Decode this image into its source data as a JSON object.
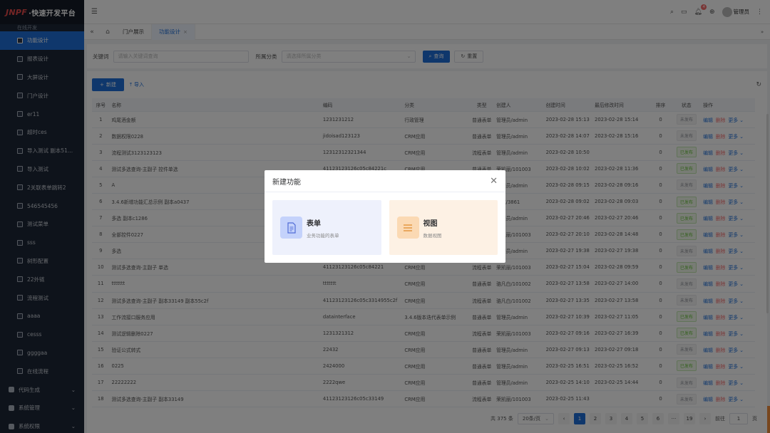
{
  "brand": {
    "logo_j": "J",
    "logo_npf": "NPF",
    "logo_rest": "·快速开发平台"
  },
  "sidebar": {
    "partial_top": "在线开发",
    "items": [
      {
        "label": "功能设计",
        "active": true
      },
      {
        "label": "报表设计"
      },
      {
        "label": "大屏设计"
      },
      {
        "label": "门户设计"
      },
      {
        "label": "er11"
      },
      {
        "label": "超时ces"
      },
      {
        "label": "导入测试 副本51..."
      },
      {
        "label": "导入测试"
      },
      {
        "label": "2关联表单跳转2"
      },
      {
        "label": "546545456"
      },
      {
        "label": "测试菜单"
      },
      {
        "label": "sss"
      },
      {
        "label": "树形配置"
      },
      {
        "label": "22外链"
      },
      {
        "label": "流程测试"
      },
      {
        "label": "aaaa"
      },
      {
        "label": "cesss"
      },
      {
        "label": "ggggaa"
      },
      {
        "label": "在线流程"
      }
    ],
    "groups": [
      {
        "label": "代码生成"
      },
      {
        "label": "系统管理"
      },
      {
        "label": "系统权限"
      }
    ]
  },
  "topbar": {
    "notification_count": "4",
    "user_name": "管理员"
  },
  "tabs": {
    "items": [
      {
        "label": "门户展示"
      },
      {
        "label": "功能设计",
        "active": true
      }
    ]
  },
  "search": {
    "keyword_label": "关键词",
    "keyword_placeholder": "请输入关键词查询",
    "category_label": "所属分类",
    "category_placeholder": "请选择所属分类",
    "query_button": "查询",
    "reset_button": "重置"
  },
  "toolbar": {
    "new_button": "新建",
    "import_button": "导入"
  },
  "table": {
    "headers": [
      "序号",
      "名称",
      "编码",
      "分类",
      "类型",
      "创建人",
      "创建时间",
      "最后修改时间",
      "排序",
      "状态",
      "操作"
    ],
    "actions": {
      "edit": "编辑",
      "delete": "删除",
      "more": "更多"
    },
    "rows": [
      [
        "1",
        "鸡尾酒金额",
        "1231231212",
        "行政管理",
        "普通表单",
        "管理员/admin",
        "2023-02-28 15:13",
        "2023-02-28 15:14",
        "0",
        "未发布"
      ],
      [
        "2",
        "数据权限0228",
        "jidoisad123123",
        "CRM应用",
        "普通表单",
        "管理员/admin",
        "2023-02-28 14:07",
        "2023-02-28 15:16",
        "0",
        "未发布"
      ],
      [
        "3",
        "流程测试3123123123",
        "12312312321344",
        "CRM应用",
        "流程表单",
        "管理员/admin",
        "2023-02-28 10:50",
        "",
        "0",
        "已发布"
      ],
      [
        "4",
        "测试多选查询-主副子 控件单选",
        "41123123126c05c84221c",
        "CRM应用",
        "普通表单",
        "荣凯丽/101003",
        "2023-02-28 10:02",
        "2023-02-28 11:36",
        "0",
        "已发布"
      ],
      [
        "5",
        "A",
        "",
        "",
        "",
        "管理员/admin",
        "2023-02-28 09:15",
        "2023-02-28 09:16",
        "0",
        "未发布"
      ],
      [
        "6",
        "3.4.6新增功能汇总示例 副本a0437",
        "",
        "",
        "",
        "测试/3861",
        "2023-02-28 09:02",
        "2023-02-28 09:03",
        "0",
        "已发布"
      ],
      [
        "7",
        "多选 副本c1286",
        "",
        "",
        "",
        "管理员/admin",
        "2023-02-27 20:46",
        "2023-02-27 20:46",
        "0",
        "已发布"
      ],
      [
        "8",
        "全部控件0227",
        "",
        "",
        "",
        "荣凯丽/101003",
        "2023-02-27 20:10",
        "2023-02-28 14:48",
        "0",
        "已发布"
      ],
      [
        "9",
        "多选",
        "",
        "",
        "",
        "管理员/admin",
        "2023-02-27 19:38",
        "2023-02-27 19:38",
        "0",
        "未发布"
      ],
      [
        "10",
        "测试多选查询-主副子 单选",
        "41123123126c05c84221",
        "CRM应用",
        "流程表单",
        "荣凯丽/101003",
        "2023-02-27 15:04",
        "2023-02-28 09:59",
        "0",
        "已发布"
      ],
      [
        "11",
        "ttttttt",
        "ttttttt",
        "CRM应用",
        "普通表单",
        "骆凡白/101002",
        "2023-02-27 13:58",
        "2023-02-27 14:00",
        "0",
        "未发布"
      ],
      [
        "12",
        "测试多选查询-主副子 副本33149 副本55c2f",
        "41123123126c05c3314955c2f",
        "CRM应用",
        "流程表单",
        "骆凡白/101002",
        "2023-02-27 13:35",
        "2023-02-27 13:58",
        "0",
        "未发布"
      ],
      [
        "13",
        "工作流接口服务应用",
        "datainterface",
        "3.4.6版本迭代表单示例",
        "普通表单",
        "管理员/admin",
        "2023-02-27 10:39",
        "2023-02-27 11:05",
        "0",
        "已发布"
      ],
      [
        "14",
        "测试逻辑删除0227",
        "1231321312",
        "CRM应用",
        "流程表单",
        "荣凯丽/101003",
        "2023-02-27 09:16",
        "2023-02-27 16:39",
        "0",
        "已发布"
      ],
      [
        "15",
        "验证公式转式",
        "22432",
        "CRM应用",
        "普通表单",
        "管理员/admin",
        "2023-02-27 09:13",
        "2023-02-27 09:18",
        "0",
        "未发布"
      ],
      [
        "16",
        "0225",
        "2424000",
        "CRM应用",
        "普通表单",
        "管理员/admin",
        "2023-02-25 16:51",
        "2023-02-25 16:52",
        "0",
        "已发布"
      ],
      [
        "17",
        "22222222",
        "2222qwe",
        "CRM应用",
        "普通表单",
        "管理员/admin",
        "2023-02-25 14:10",
        "2023-02-25 14:44",
        "0",
        "未发布"
      ],
      [
        "18",
        "测试多选查询-主副子 副本33149",
        "41123123126c05c33149",
        "CRM应用",
        "流程表单",
        "荣凯丽/101003",
        "2023-02-25 11:43",
        "",
        "0",
        "未发布"
      ]
    ]
  },
  "pager": {
    "total": "共 375 条",
    "page_size": "20条/页",
    "pages": [
      "1",
      "2",
      "3",
      "4",
      "5",
      "6",
      "···",
      "19"
    ],
    "goto_label": "前往",
    "goto_value": "1",
    "page_unit": "页"
  },
  "modal": {
    "title": "新建功能",
    "cards": [
      {
        "title": "表单",
        "subtitle": "业务功能的表单"
      },
      {
        "title": "视图",
        "subtitle": "数据视图"
      }
    ]
  }
}
